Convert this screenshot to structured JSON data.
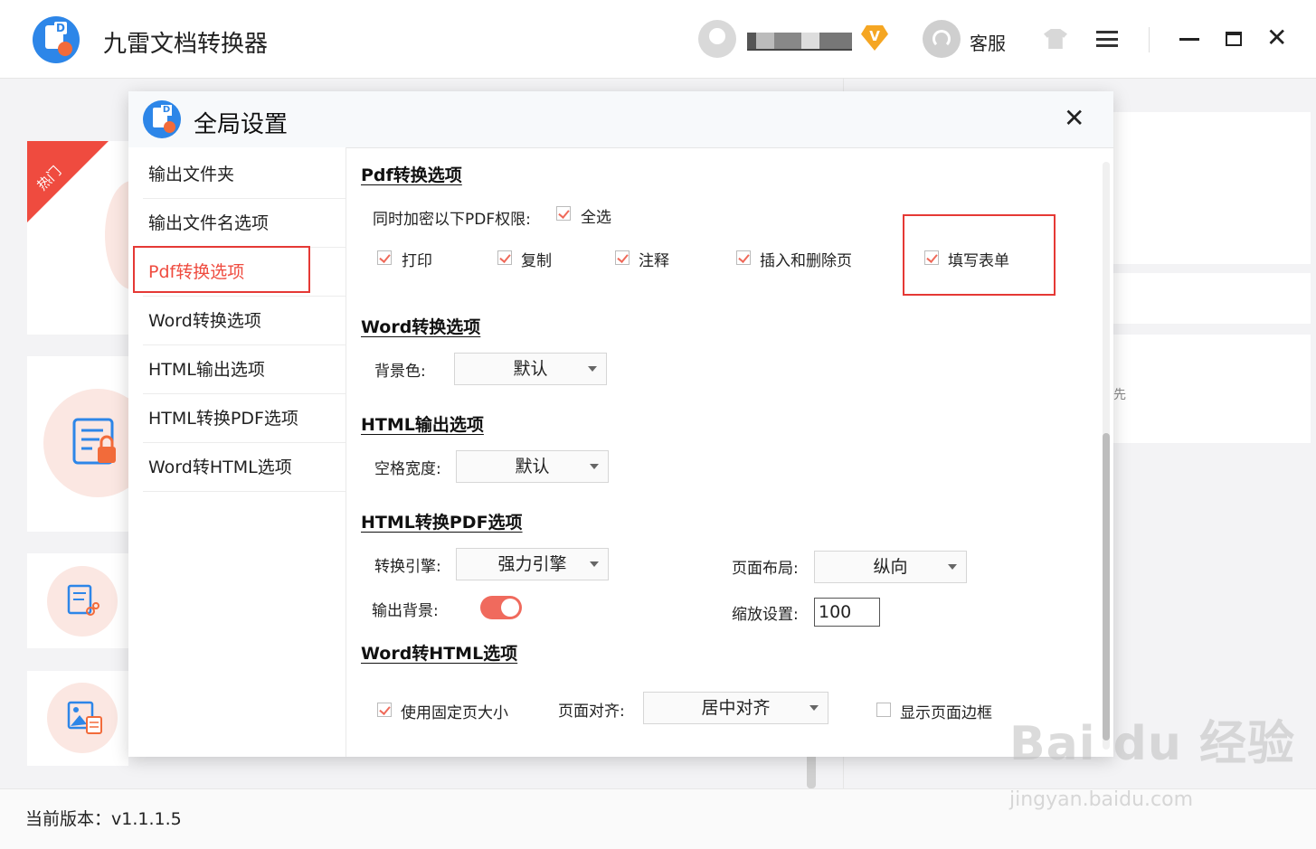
{
  "app": {
    "title": "九雷文档转换器",
    "customer_service": "客服",
    "vip_badge": "V",
    "version_text": "当前版本：v1.1.1.5",
    "hot_ribbon": "热门",
    "watermark": "Bai du 经验",
    "watermark_url": "jingyan.baidu.com",
    "bg_partial_text": "先"
  },
  "dialog": {
    "title": "全局设置",
    "sidebar": [
      {
        "label": "输出文件夹"
      },
      {
        "label": "输出文件名选项"
      },
      {
        "label": "Pdf转换选项"
      },
      {
        "label": "Word转换选项"
      },
      {
        "label": "HTML输出选项"
      },
      {
        "label": "HTML转换PDF选项"
      },
      {
        "label": "Word转HTML选项"
      }
    ],
    "pdf": {
      "title": "Pdf转换选项",
      "encrypt_label": "同时加密以下PDF权限:",
      "select_all": "全选",
      "perms": [
        "打印",
        "复制",
        "注释",
        "插入和删除页",
        "填写表单"
      ]
    },
    "word": {
      "title": "Word转换选项",
      "bg_label": "背景色:",
      "bg_value": "默认"
    },
    "html_out": {
      "title": "HTML输出选项",
      "space_label": "空格宽度:",
      "space_value": "默认"
    },
    "html_pdf": {
      "title": "HTML转换PDF选项",
      "engine_label": "转换引擎:",
      "engine_value": "强力引擎",
      "layout_label": "页面布局:",
      "layout_value": "纵向",
      "bg_label": "输出背景:",
      "bg_enabled": true,
      "zoom_label": "缩放设置:",
      "zoom_value": "100"
    },
    "word_html": {
      "title": "Word转HTML选项",
      "fixed_size": "使用固定页大小",
      "fixed_size_checked": true,
      "align_label": "页面对齐:",
      "align_value": "居中对齐",
      "show_border": "显示页面边框",
      "show_border_checked": false
    }
  },
  "colors": {
    "accent": "#ef4b3f",
    "highlight": "#e53935",
    "brand": "#2d86e8"
  }
}
